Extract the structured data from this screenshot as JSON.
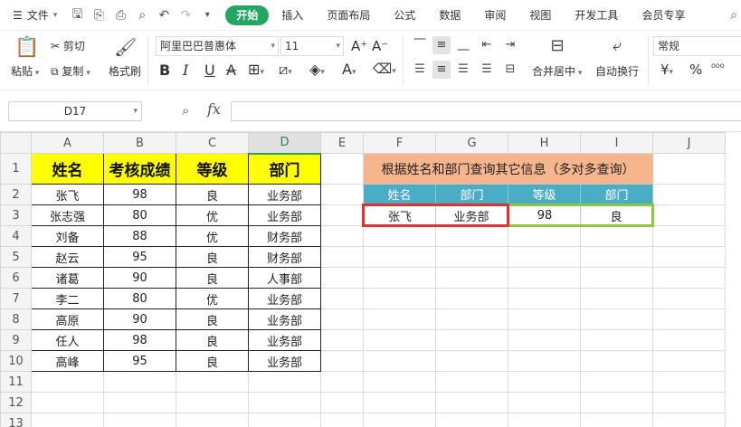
{
  "menubar": {
    "file_label": "文件",
    "tabs": [
      "开始",
      "插入",
      "页面布局",
      "公式",
      "数据",
      "审阅",
      "视图",
      "开发工具",
      "会员专享"
    ]
  },
  "ribbon": {
    "paste": "粘贴",
    "cut": "剪切",
    "copy": "复制",
    "format_painter": "格式刷",
    "font_name": "阿里巴巴普惠体",
    "font_size": "11",
    "merge_center": "合并居中",
    "wrap_text": "自动换行",
    "number_format": "常规"
  },
  "formula_bar": {
    "name_box": "D17",
    "fx_label": "fx",
    "formula": ""
  },
  "sheet": {
    "columns": [
      "A",
      "B",
      "C",
      "D",
      "E",
      "F",
      "G",
      "H",
      "I",
      "J"
    ],
    "rows": [
      "1",
      "2",
      "3",
      "4",
      "5",
      "6",
      "7",
      "8",
      "9",
      "10",
      "11",
      "12",
      "13"
    ],
    "headers": [
      "姓名",
      "考核成绩",
      "等级",
      "部门"
    ],
    "data": [
      [
        "张飞",
        "98",
        "良",
        "业务部"
      ],
      [
        "张志强",
        "80",
        "优",
        "业务部"
      ],
      [
        "刘备",
        "88",
        "优",
        "财务部"
      ],
      [
        "赵云",
        "95",
        "良",
        "财务部"
      ],
      [
        "诸葛",
        "90",
        "良",
        "人事部"
      ],
      [
        "李二",
        "80",
        "优",
        "业务部"
      ],
      [
        "高原",
        "90",
        "良",
        "业务部"
      ],
      [
        "任人",
        "98",
        "良",
        "业务部"
      ],
      [
        "高峰",
        "95",
        "良",
        "业务部"
      ]
    ],
    "query_title": "根据姓名和部门查询其它信息（多对多查询）",
    "query_headers": [
      "姓名",
      "部门",
      "等级",
      "部门"
    ],
    "query_row": [
      "张飞",
      "业务部",
      "98",
      "良"
    ]
  },
  "colors": {
    "accent": "#25a660",
    "header_yellow": "#ffff00",
    "title_orange": "#f6b58c",
    "query_header_blue": "#4bacc6",
    "input_box_red": "#e03030",
    "result_box_green": "#8ec63f"
  }
}
